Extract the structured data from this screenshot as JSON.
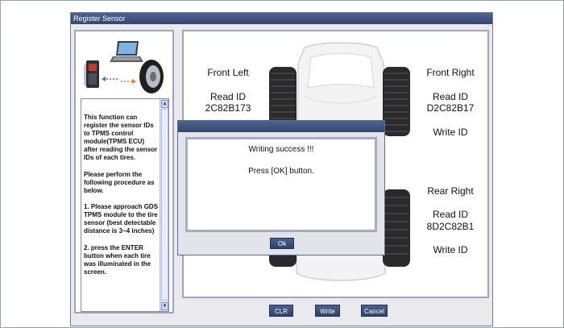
{
  "window": {
    "title": "Register Sensor"
  },
  "instructions": "This function can register the sensor IDs to TPMS control module(TPMS ECU) after reading the sensor IDs of each tires.\n\nPlease perform the following procedure as below.\n\n1. Please approach GDS TPMS module to the tire sensor (best detectable distance is 3~4 inches)\n\n2. press the ENTER button when each tire was illuminated in the screen.",
  "scroll": {
    "up": "▲",
    "down": "▼"
  },
  "tires": {
    "front_left": {
      "name": "Front Left",
      "read_label": "Read ID",
      "read_id": "2C82B173"
    },
    "front_right": {
      "name": "Front Right",
      "read_label": "Read ID",
      "read_id": "D2C82B17",
      "write_label": "Write ID"
    },
    "rear_right": {
      "name": "Rear Right",
      "read_label": "Read ID",
      "read_id": "8D2C82B1",
      "write_label": "Write ID"
    }
  },
  "buttons": {
    "clr": "CLR",
    "write": "Write",
    "cancel": "Cancel"
  },
  "dialog": {
    "line1": "Writing success !!!",
    "line2": "Press [OK] button.",
    "ok": "Ok"
  },
  "colors": {
    "titlebar": "#3e5280",
    "panel_border": "#9ea3c0",
    "button": "#3a4d7a"
  }
}
